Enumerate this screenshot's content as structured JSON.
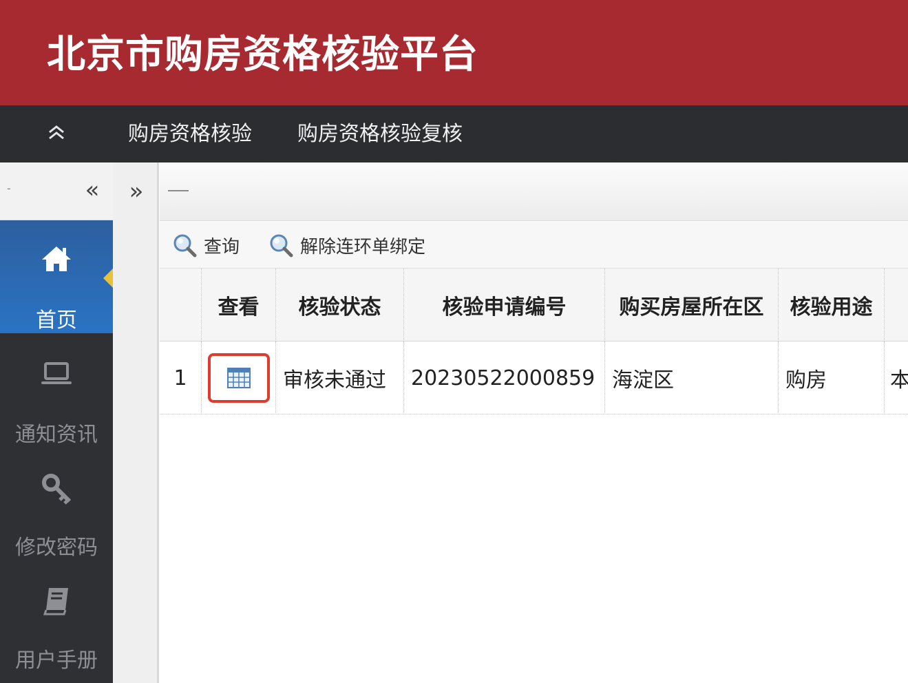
{
  "header": {
    "title": "北京市购房资格核验平台"
  },
  "top_nav": {
    "collapse_icon": "double-chevron-up-icon",
    "items": [
      {
        "label": "购房资格核验"
      },
      {
        "label": "购房资格核验复核"
      }
    ]
  },
  "sidebar": {
    "head_dash": "-",
    "collapse_icon": "«",
    "items": [
      {
        "label": "首页",
        "icon": "home-icon",
        "active": true
      },
      {
        "label": "通知资讯",
        "icon": "laptop-icon",
        "active": false
      },
      {
        "label": "修改密码",
        "icon": "key-icon",
        "active": false
      },
      {
        "label": "用户手册",
        "icon": "book-icon",
        "active": false
      }
    ]
  },
  "splitter": {
    "expand_icon": "»"
  },
  "toolbar": {
    "buttons": [
      {
        "label": "查询",
        "icon": "search-icon"
      },
      {
        "label": "解除连环单绑定",
        "icon": "search-icon"
      }
    ]
  },
  "grid": {
    "columns": [
      "查看",
      "核验状态",
      "核验申请编号",
      "购买房屋所在区",
      "核验用途"
    ],
    "rows": [
      {
        "row_number": "1",
        "view_icon": "calendar-grid-icon",
        "status": "审核未通过",
        "application_no": "20230522000859",
        "district": "海淀区",
        "purpose": "购房",
        "more": "本"
      }
    ]
  },
  "colors": {
    "header_red": "#a82a31",
    "nav_dark": "#2b2d31",
    "sidebar_active_blue": "#2a73c4",
    "highlight_red": "#e03b2f"
  }
}
